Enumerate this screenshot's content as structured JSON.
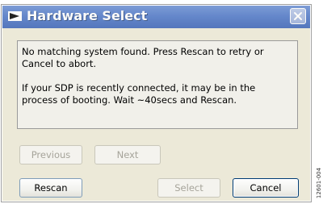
{
  "window": {
    "title": "Hardware Select",
    "logo_icon": "analog-devices-logo-icon",
    "close_icon": "close-icon"
  },
  "message": {
    "line1": "No matching system found. Press Rescan to retry or Cancel to abort.",
    "line2": "If your SDP is recently connected, it may be in the process of booting. Wait ~40secs and Rescan."
  },
  "buttons": {
    "previous": {
      "label": "Previous",
      "enabled": false
    },
    "next": {
      "label": "Next",
      "enabled": false
    },
    "rescan": {
      "label": "Rescan",
      "enabled": true
    },
    "select": {
      "label": "Select",
      "enabled": false
    },
    "cancel": {
      "label": "Cancel",
      "enabled": true
    }
  },
  "figure_code": "12601-004",
  "colors": {
    "titlebar": "#4e77c9",
    "dialog_bg": "#ece9d8",
    "panel_bg": "#f1f0ea",
    "disabled_text": "#a6a49a"
  }
}
